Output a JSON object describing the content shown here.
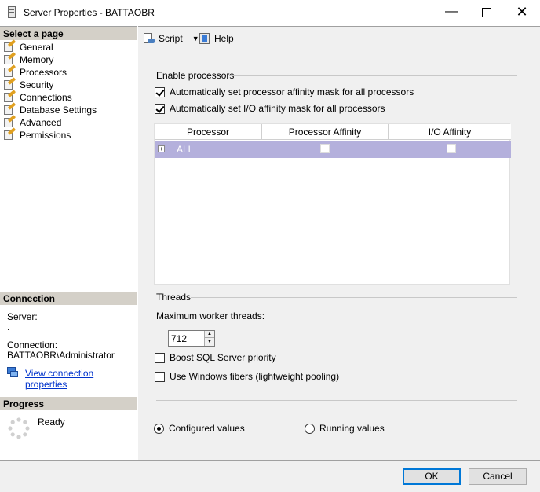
{
  "window": {
    "title": "Server Properties - BATTAOBR",
    "minimize": "—",
    "close": "✕"
  },
  "sidebar": {
    "select_page_header": "Select a page",
    "pages": [
      {
        "label": "General"
      },
      {
        "label": "Memory"
      },
      {
        "label": "Processors"
      },
      {
        "label": "Security"
      },
      {
        "label": "Connections"
      },
      {
        "label": "Database Settings"
      },
      {
        "label": "Advanced"
      },
      {
        "label": "Permissions"
      }
    ],
    "connection_header": "Connection",
    "server_label": "Server:",
    "server_value": ".",
    "connection_label": "Connection:",
    "connection_value": "BATTAOBR\\Administrator",
    "view_connection_link": "View connection properties",
    "progress_header": "Progress",
    "progress_status": "Ready"
  },
  "toolbar": {
    "script_label": "Script",
    "help_label": "Help"
  },
  "processors": {
    "enable_group_label": "Enable processors",
    "auto_processor_affinity": {
      "label": "Automatically set processor affinity mask for all processors",
      "checked": true
    },
    "auto_io_affinity": {
      "label": "Automatically set I/O affinity mask for all processors",
      "checked": true
    },
    "grid": {
      "columns": [
        "Processor",
        "Processor Affinity",
        "I/O Affinity"
      ],
      "rows": [
        {
          "processor": "ALL",
          "processor_affinity": false,
          "io_affinity": false
        }
      ]
    },
    "threads_group_label": "Threads",
    "max_worker_threads_label": "Maximum worker threads:",
    "max_worker_threads_value": "712",
    "boost_priority": {
      "label": "Boost SQL Server priority",
      "checked": false
    },
    "use_fibers": {
      "label": "Use Windows fibers (lightweight pooling)",
      "checked": false
    },
    "configured_values_label": "Configured  values",
    "running_values_label": "Running values",
    "selected_values": "configured"
  },
  "buttons": {
    "ok_label": "OK",
    "cancel_label": "Cancel"
  }
}
